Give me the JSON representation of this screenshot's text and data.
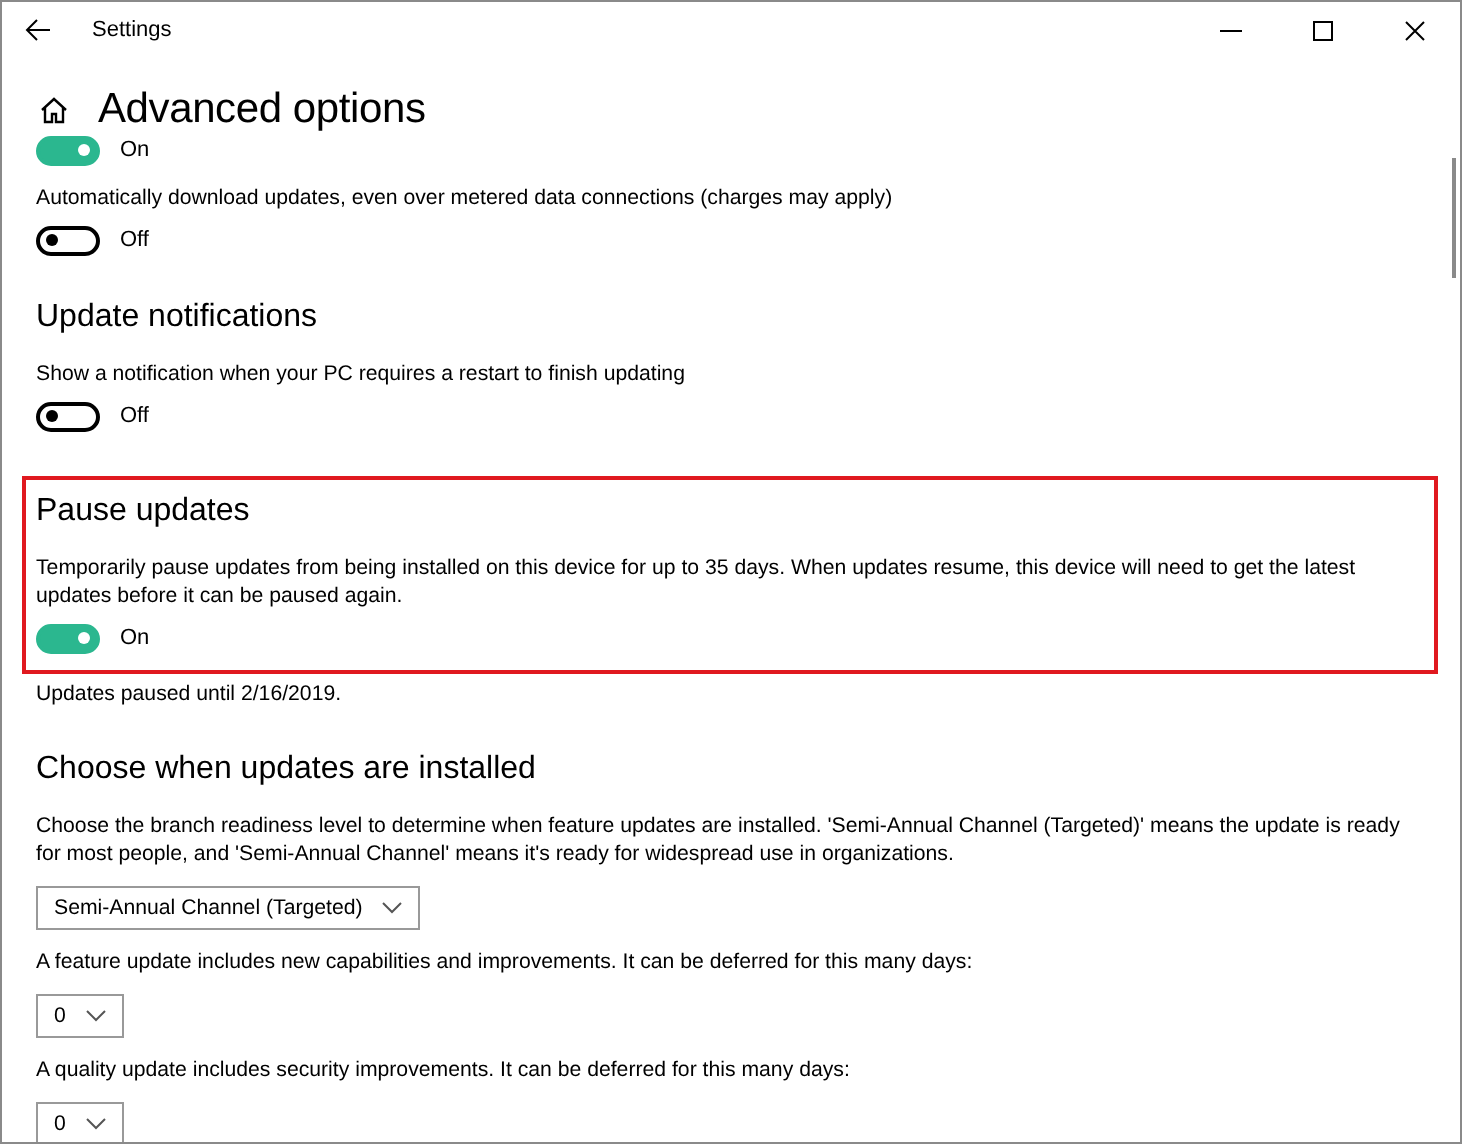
{
  "window": {
    "title": "Settings"
  },
  "page_title": "Advanced options",
  "items": [
    {
      "kind": "toggle",
      "on": true,
      "state_text": "On"
    },
    {
      "kind": "text",
      "text": "Automatically download updates, even over metered data connections (charges may apply)"
    },
    {
      "kind": "toggle",
      "on": false,
      "state_text": "Off"
    },
    {
      "kind": "heading",
      "text": "Update notifications"
    },
    {
      "kind": "text",
      "text": "Show a notification when your PC requires a restart to finish updating"
    },
    {
      "kind": "toggle",
      "on": false,
      "state_text": "Off"
    },
    {
      "kind": "group",
      "highlighted": true,
      "children": [
        {
          "kind": "heading",
          "text": "Pause updates"
        },
        {
          "kind": "text",
          "text": "Temporarily pause updates from being installed on this device for up to 35 days. When updates resume, this device will need to get the latest updates before it can be paused again."
        },
        {
          "kind": "toggle",
          "on": true,
          "state_text": "On"
        }
      ]
    },
    {
      "kind": "text",
      "text": "Updates paused until 2/16/2019."
    },
    {
      "kind": "heading",
      "text": "Choose when updates are installed"
    },
    {
      "kind": "text",
      "text": "Choose the branch readiness level to determine when feature updates are installed. 'Semi-Annual Channel (Targeted)' means the update is ready for most people, and 'Semi-Annual Channel' means it's ready for widespread use in organizations."
    },
    {
      "kind": "select",
      "value": "Semi-Annual Channel (Targeted)"
    },
    {
      "kind": "text",
      "text": "A feature update includes new capabilities and improvements. It can be deferred for this many days:"
    },
    {
      "kind": "select",
      "value": "0"
    },
    {
      "kind": "text",
      "text": "A quality update includes security improvements. It can be deferred for this many days:"
    },
    {
      "kind": "select",
      "value": "0"
    }
  ]
}
